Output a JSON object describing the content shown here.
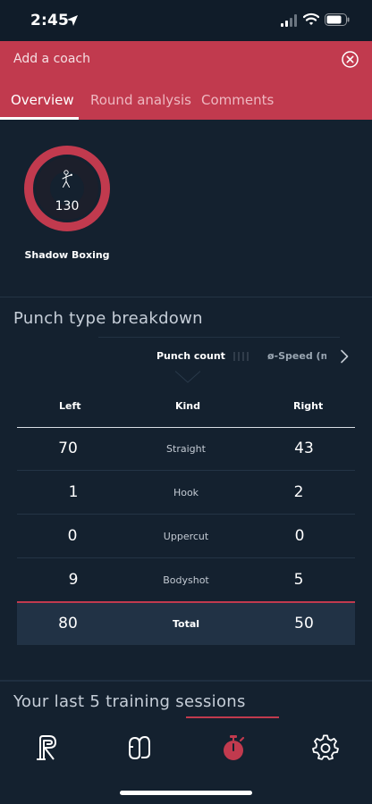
{
  "status_bar": {
    "time": "2:45"
  },
  "coach_bar": {
    "label": "Add a coach"
  },
  "tabs": [
    {
      "label": "Overview",
      "active": true
    },
    {
      "label": "Round analysis",
      "active": false
    },
    {
      "label": "Comments",
      "active": false
    }
  ],
  "activity": {
    "value": "130",
    "label": "Shadow Boxing"
  },
  "breakdown": {
    "title": "Punch type breakdown",
    "metric_active": "Punch count",
    "metric_next": "ø-Speed (mph)",
    "columns": {
      "left": "Left",
      "kind": "Kind",
      "right": "Right"
    },
    "rows": [
      {
        "left": "70",
        "kind": "Straight",
        "right": "43"
      },
      {
        "left": "1",
        "kind": "Hook",
        "right": "2"
      },
      {
        "left": "0",
        "kind": "Uppercut",
        "right": "0"
      },
      {
        "left": "9",
        "kind": "Bodyshot",
        "right": "5"
      }
    ],
    "total": {
      "left": "80",
      "kind": "Total",
      "right": "50"
    }
  },
  "sessions": {
    "title": "Your last 5 training sessions"
  },
  "nav": [
    {
      "icon": "rise-logo-icon",
      "active": false
    },
    {
      "icon": "gloves-icon",
      "active": false
    },
    {
      "icon": "stopwatch-icon",
      "active": true
    },
    {
      "icon": "gear-icon",
      "active": false
    }
  ],
  "colors": {
    "accent": "#c13a4e",
    "background": "#14212f",
    "ring": "#c13a4e"
  }
}
